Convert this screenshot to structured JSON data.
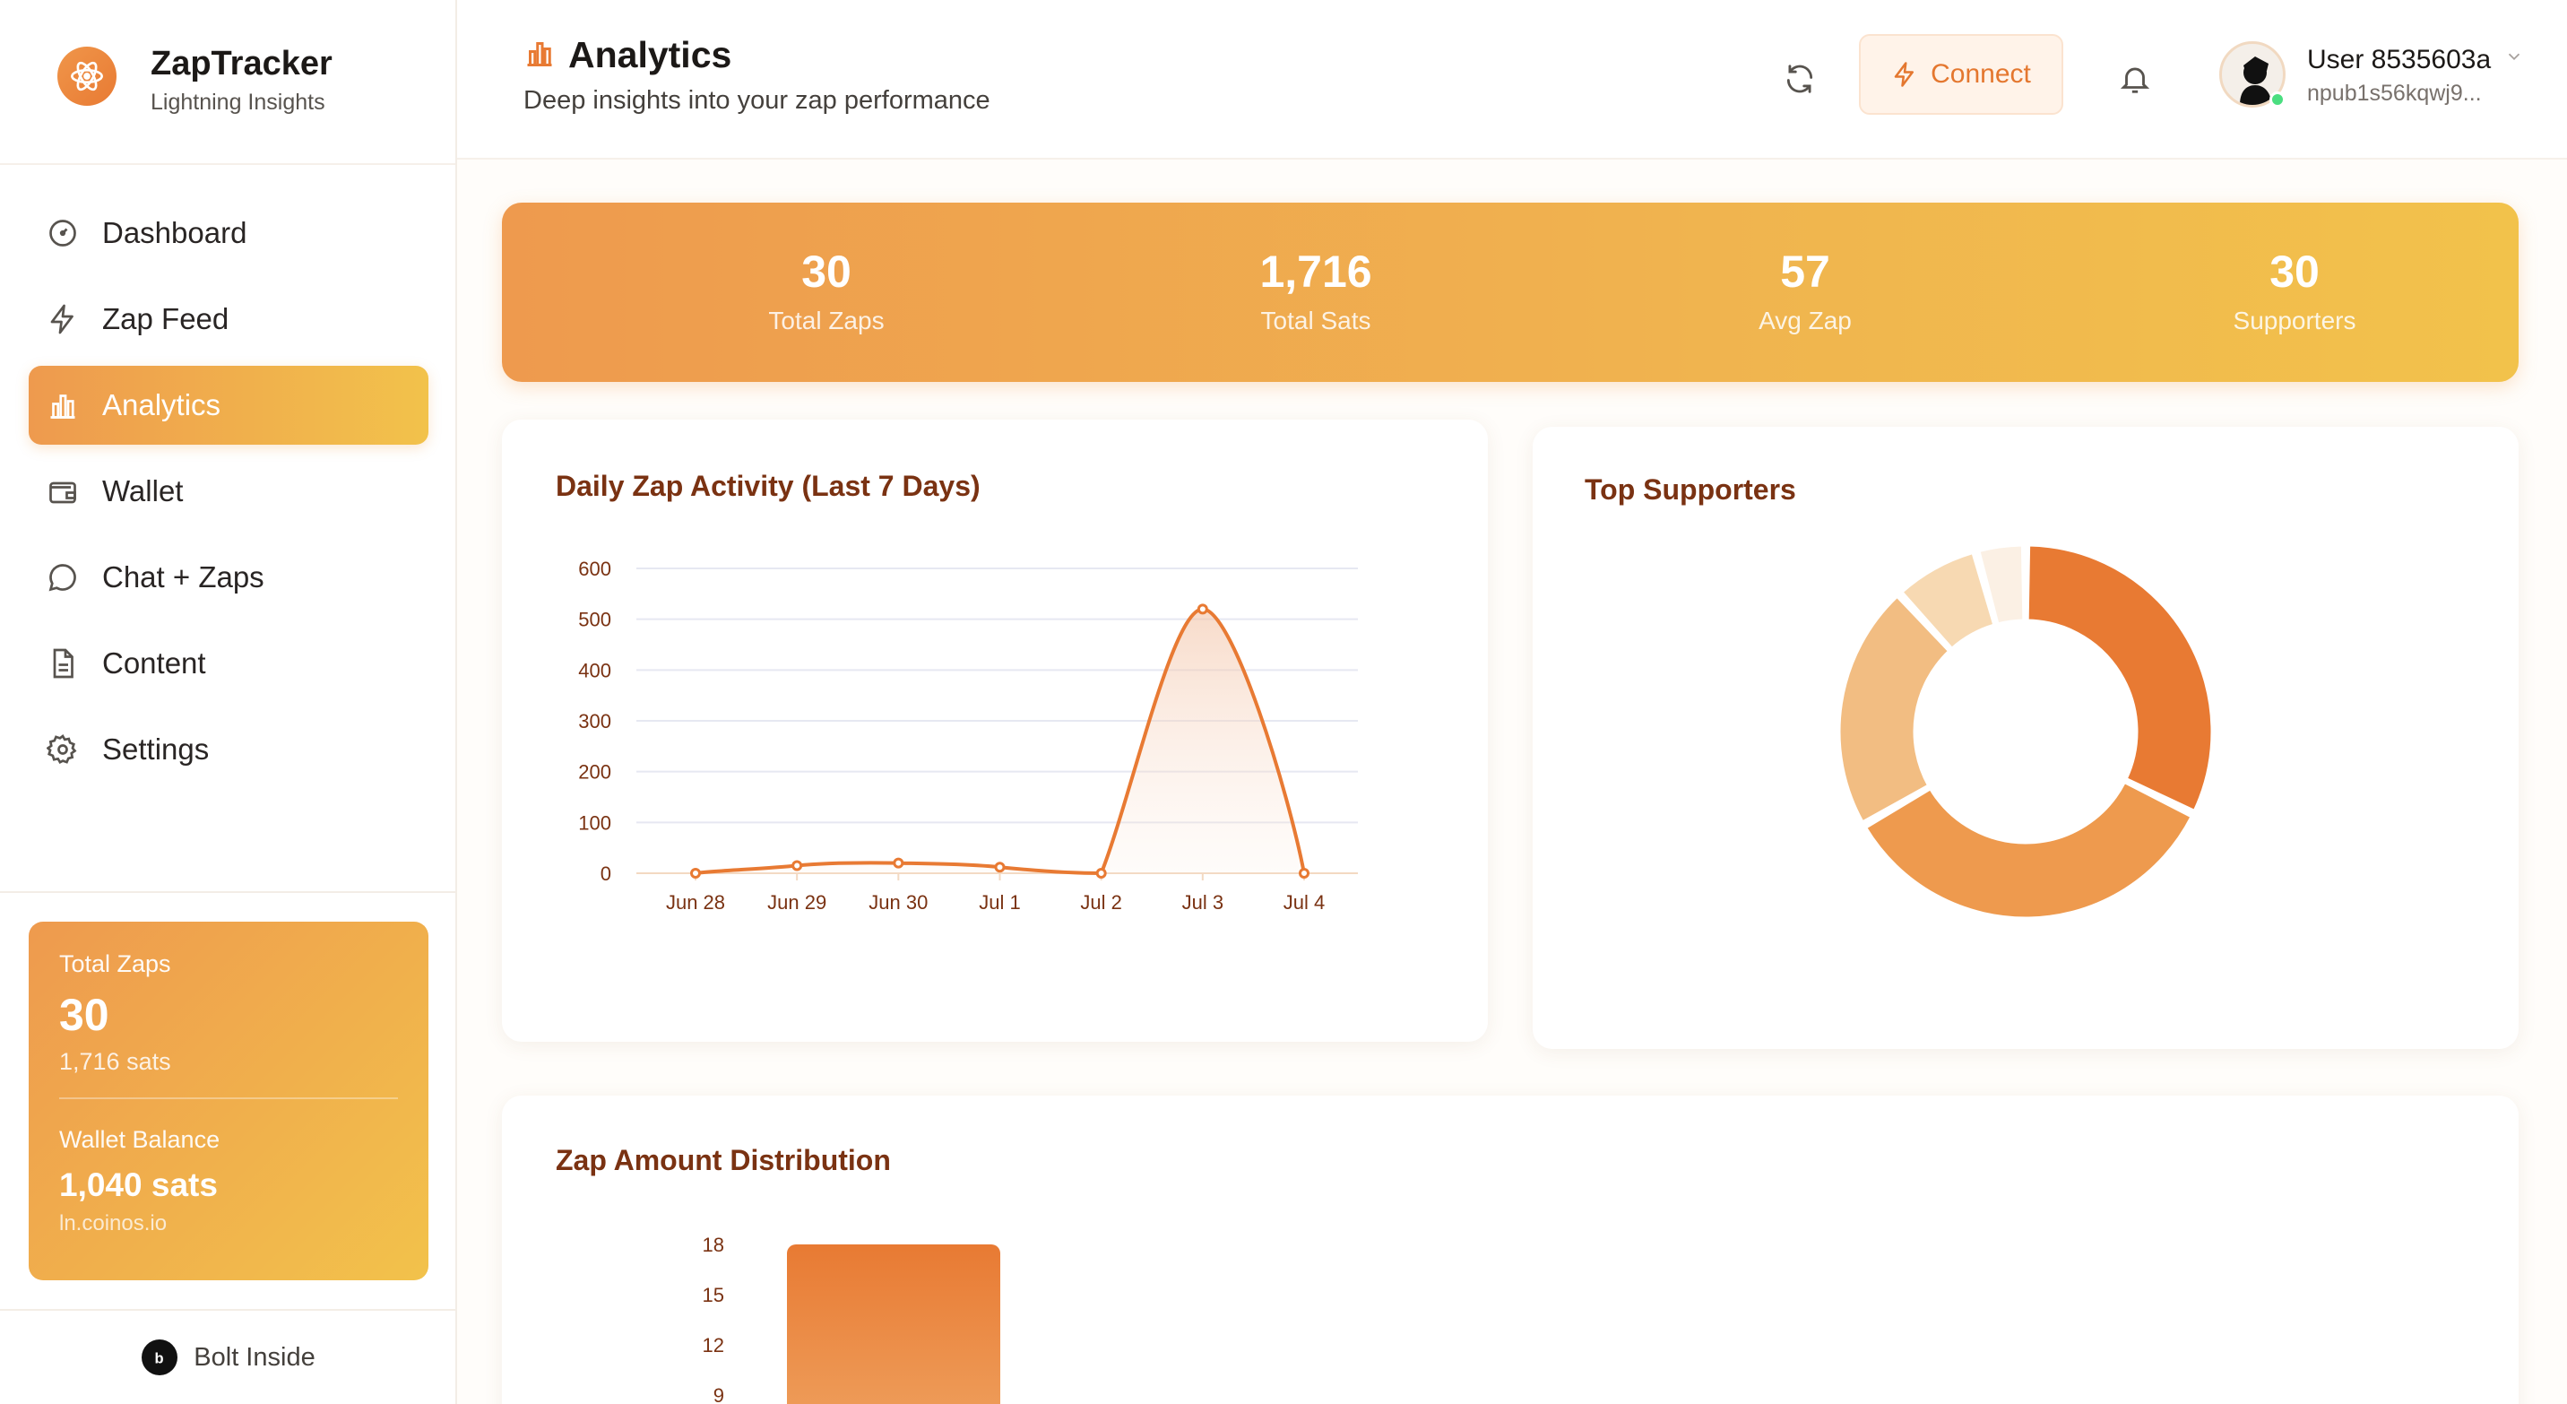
{
  "brand": {
    "name": "ZapTracker",
    "subtitle": "Lightning Insights"
  },
  "nav": [
    {
      "label": "Dashboard",
      "icon": "dashboard-icon"
    },
    {
      "label": "Zap Feed",
      "icon": "bolt-icon"
    },
    {
      "label": "Analytics",
      "icon": "bar-chart-icon",
      "active": true
    },
    {
      "label": "Wallet",
      "icon": "wallet-icon"
    },
    {
      "label": "Chat + Zaps",
      "icon": "chat-icon"
    },
    {
      "label": "Content",
      "icon": "document-icon"
    },
    {
      "label": "Settings",
      "icon": "gear-icon"
    }
  ],
  "sidebar_stats": {
    "total_zaps_label": "Total Zaps",
    "total_zaps": "30",
    "total_sats": "1,716 sats",
    "wallet_label": "Wallet Balance",
    "wallet_balance": "1,040 sats",
    "wallet_host": "ln.coinos.io"
  },
  "footer": {
    "label": "Bolt Inside"
  },
  "header": {
    "title": "Analytics",
    "subtitle": "Deep insights into your zap performance",
    "connect_label": "Connect",
    "user_name": "User 8535603a",
    "user_npub": "npub1s56kqwj9..."
  },
  "summary": [
    {
      "value": "30",
      "label": "Total Zaps"
    },
    {
      "value": "1,716",
      "label": "Total Sats"
    },
    {
      "value": "57",
      "label": "Avg Zap"
    },
    {
      "value": "30",
      "label": "Supporters"
    }
  ],
  "colors": {
    "accent": "#e87a33",
    "gradient_start": "#ee9a4e",
    "gradient_end": "#f2c24b",
    "title_brown": "#7a3212"
  },
  "chart_data": [
    {
      "type": "line",
      "title": "Daily Zap Activity (Last 7 Days)",
      "categories": [
        "Jun 28",
        "Jun 29",
        "Jun 30",
        "Jul 1",
        "Jul 2",
        "Jul 3",
        "Jul 4"
      ],
      "values": [
        0,
        15,
        20,
        12,
        0,
        520,
        0
      ],
      "ylim": [
        0,
        600
      ],
      "yticks": [
        0,
        100,
        200,
        300,
        400,
        500,
        600
      ],
      "grid": true
    },
    {
      "type": "pie",
      "title": "Top Supporters",
      "values": [
        30,
        32,
        20,
        7,
        4
      ],
      "colors": [
        "#e87a33",
        "#ee9a4e",
        "#f2bd82",
        "#f7d9b2",
        "#fbf0e4"
      ]
    },
    {
      "type": "bar",
      "title": "Zap Amount Distribution",
      "values": [
        18
      ],
      "yticks": [
        9,
        12,
        15,
        18
      ]
    }
  ]
}
